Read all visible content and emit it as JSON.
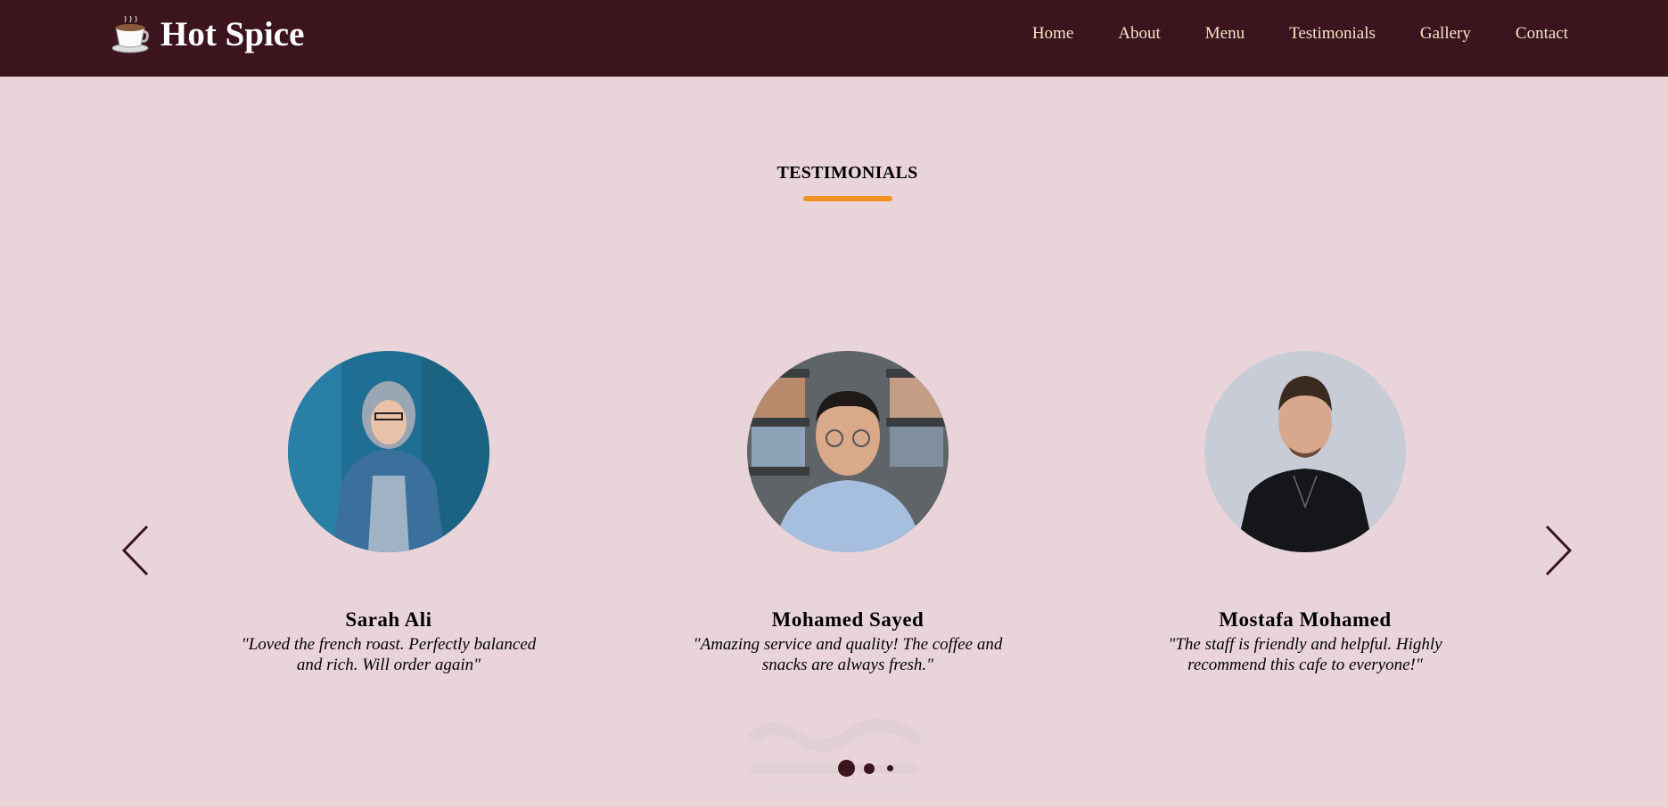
{
  "brand": {
    "name": "Hot Spice",
    "logo_icon": "coffee-cup-icon"
  },
  "nav": {
    "items": [
      {
        "label": "Home"
      },
      {
        "label": "About"
      },
      {
        "label": "Menu"
      },
      {
        "label": "Testimonials"
      },
      {
        "label": "Gallery"
      },
      {
        "label": "Contact"
      }
    ]
  },
  "section": {
    "title": "TESTIMONIALS"
  },
  "carousel": {
    "prev_icon": "chevron-left-icon",
    "next_icon": "chevron-right-icon",
    "active_index": 0,
    "dot_count": 3
  },
  "testimonials": [
    {
      "name": "Sarah Ali",
      "quote": "\"Loved the french roast. Perfectly balanced and rich. Will order again\""
    },
    {
      "name": "Mohamed Sayed",
      "quote": "\"Amazing service and quality! The coffee and snacks are always fresh.\""
    },
    {
      "name": "Mostafa Mohamed",
      "quote": "\"The staff is friendly and helpful. Highly recommend this cafe to everyone!\""
    }
  ],
  "colors": {
    "header_bg": "#3b141e",
    "page_bg": "#e9d5d9",
    "accent": "#f0921f",
    "nav_text": "#f5e6c8"
  }
}
